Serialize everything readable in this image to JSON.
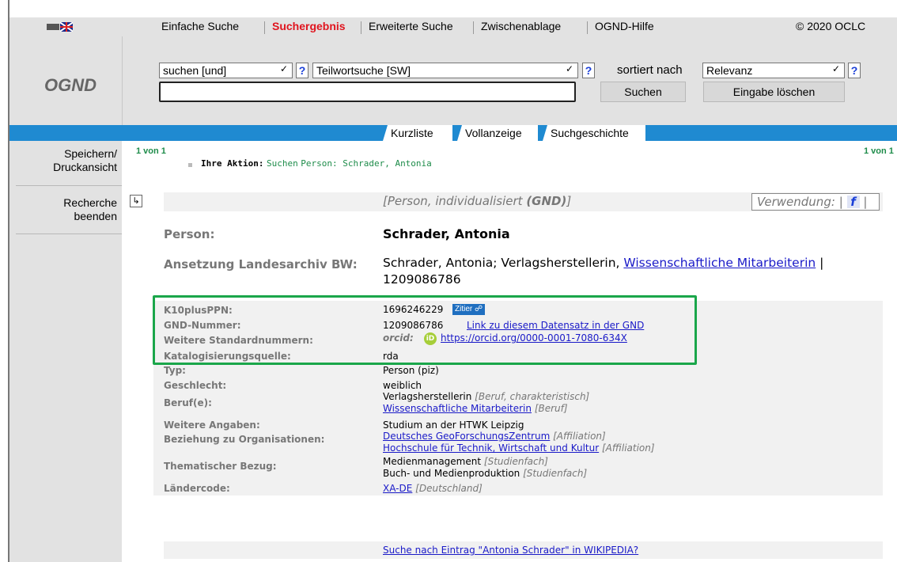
{
  "topnav": {
    "items": [
      "Einfache Suche",
      "Suchergebnis",
      "Erweiterte Suche",
      "Zwischenablage",
      "OGND-Hilfe"
    ],
    "active_index": 1,
    "copyright": "© 2020 OCLC"
  },
  "brand": {
    "title": "OGND"
  },
  "search": {
    "operator_value": "suchen [und]",
    "index_value": "Teilwortsuche [SW]",
    "sort_label": "sortiert nach",
    "sort_value": "Relevanz",
    "help_label": "?",
    "query_value": "",
    "search_button": "Suchen",
    "clear_button": "Eingabe löschen"
  },
  "view_tabs": [
    "Kurzliste",
    "Vollanzeige",
    "Suchgeschichte"
  ],
  "sidebar": {
    "items": [
      {
        "line1": "Speichern/",
        "line2": "Druckansicht"
      },
      {
        "line1": "Recherche",
        "line2": "beenden"
      }
    ]
  },
  "pager": {
    "left": "1 von 1",
    "right": "1 von 1"
  },
  "action": {
    "label": "Ihre Aktion:",
    "verb": "Suchen",
    "query": "Person: Schrader, Antonia"
  },
  "record": {
    "type_heading_prefix": "[Person, individualisiert ",
    "type_heading_bold": "(GND)",
    "type_heading_suffix": "]",
    "verwendung_label": "Verwendung:",
    "verwendung_icon": "f",
    "person_label": "Person:",
    "person_value": "Schrader, Antonia",
    "ansetzung_label": "Ansetzung Landesarchiv BW:",
    "ansetzung_text": "Schrader, Antonia; Verlagsherstellerin,",
    "ansetzung_link": "Wissenschaftliche Mitarbeiterin",
    "ansetzung_sep": "|",
    "ansetzung_id": "1209086786"
  },
  "details": {
    "k10_label": "K10plusPPN:",
    "k10_value": "1696246229",
    "zitier_label": "Zitier",
    "gnd_label": "GND-Nummer:",
    "gnd_value": "1209086786",
    "gnd_link": "Link zu diesem Datensatz in der GND",
    "std_label": "Weitere Standardnummern:",
    "std_prefix": "orcid:",
    "std_icon": "iD",
    "std_value": "https://orcid.org/0000-0001-7080-634X",
    "quelle_label": "Katalogisierungsquelle:",
    "quelle_value": "rda",
    "typ_label": "Typ:",
    "typ_value": "Person (piz)",
    "geschlecht_label": "Geschlecht:",
    "geschlecht_value": "weiblich",
    "beruf_label": "Beruf(e):",
    "beruf1_text": "Verlagsherstellerin",
    "beruf1_note": "[Beruf, charakteristisch]",
    "beruf2_link": "Wissenschaftliche Mitarbeiterin",
    "beruf2_note": "[Beruf]",
    "angaben_label": "Weitere Angaben:",
    "angaben_value": "Studium an der HTWK Leipzig",
    "org_label": "Beziehung zu Organisationen:",
    "org1_link": "Deutsches GeoForschungsZentrum",
    "org1_note": "[Affiliation]",
    "org2_link": "Hochschule für Technik, Wirtschaft und Kultur",
    "org2_note": "[Affiliation]",
    "thema_label": "Thematischer Bezug:",
    "thema1_text": "Medienmanagement",
    "thema1_note": "[Studienfach]",
    "thema2_text": "Buch- und Medienproduktion",
    "thema2_note": "[Studienfach]",
    "land_label": "Ländercode:",
    "land_link": "XA-DE",
    "land_note": "[Deutschland]"
  },
  "wikipedia": {
    "prefix": "Suche nach Eintrag ",
    "quoted": "\"Antonia Schrader\"",
    "suffix": " in WIKIPEDIA?"
  },
  "colors": {
    "accent_blue": "#1f8ad1",
    "active_tab_red": "#e0141e",
    "highlight_green": "#1aa64a",
    "orcid_green": "#a6ce39"
  }
}
